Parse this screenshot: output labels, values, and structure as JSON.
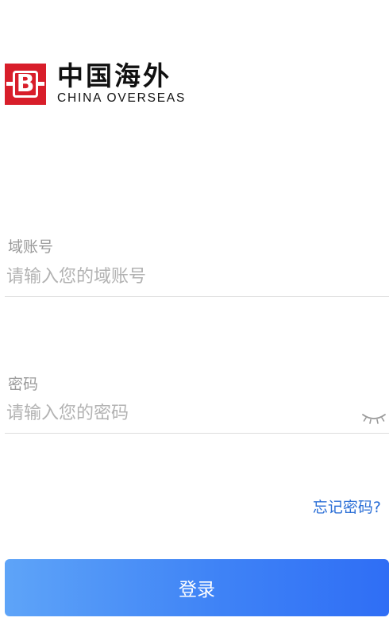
{
  "brand": {
    "logo_letter": "B",
    "name_cn": "中国海外",
    "name_en": "CHINA OVERSEAS",
    "color": "#d81e2a"
  },
  "form": {
    "account": {
      "label": "域账号",
      "placeholder": "请输入您的域账号",
      "value": ""
    },
    "password": {
      "label": "密码",
      "placeholder": "请输入您的密码",
      "value": "",
      "toggle_icon": "eye-closed-icon"
    },
    "forgot_label": "忘记密码?",
    "submit_label": "登录"
  },
  "colors": {
    "link": "#2a6ed6",
    "button_gradient_start": "#5ea4f8",
    "button_gradient_end": "#2f6ef5",
    "placeholder": "#b2b2b2",
    "label": "#9a9a9a"
  }
}
